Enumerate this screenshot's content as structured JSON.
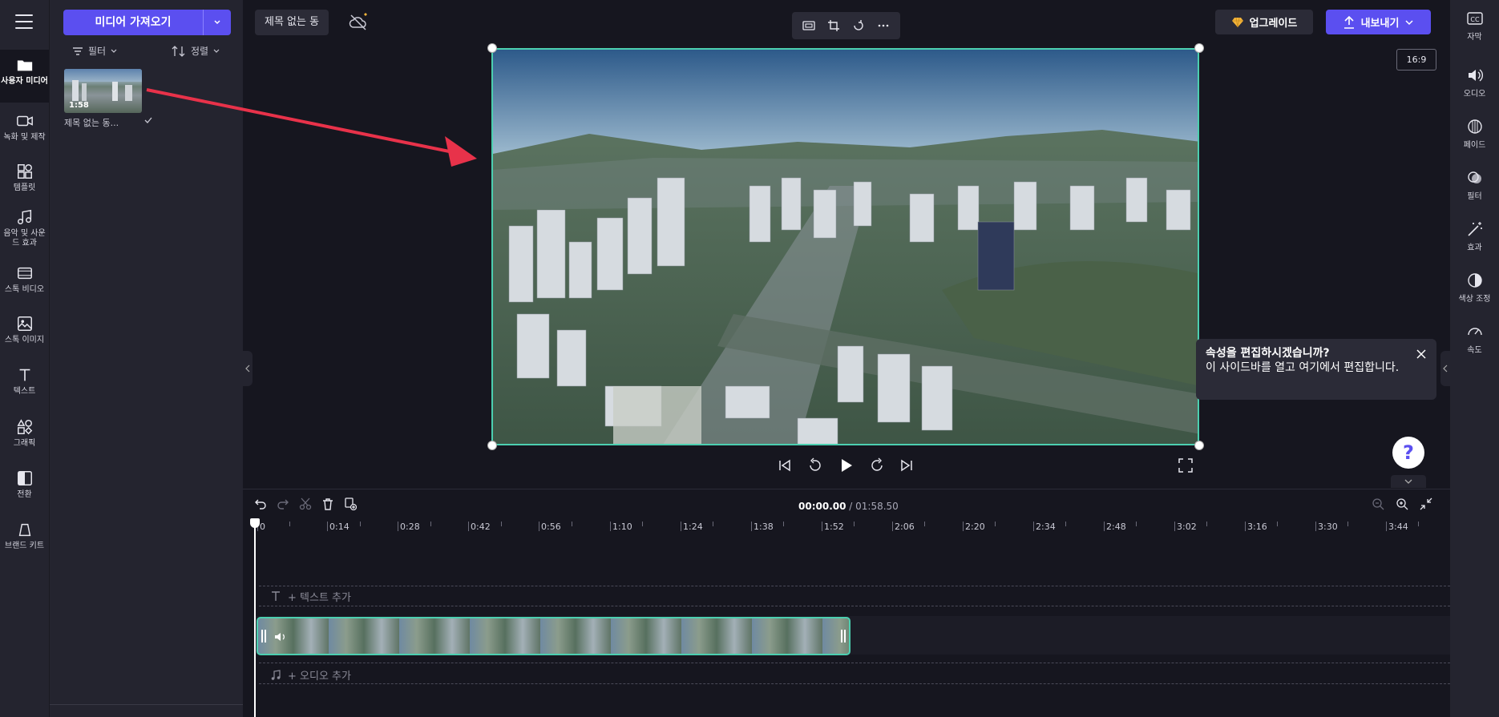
{
  "left_nav": {
    "items": [
      {
        "label": "사용자 미디어"
      },
      {
        "label": "녹화 및 제작"
      },
      {
        "label": "템플릿"
      },
      {
        "label": "음악 및 사운드 효과"
      },
      {
        "label": "스톡 비디오"
      },
      {
        "label": "스톡 이미지"
      },
      {
        "label": "텍스트"
      },
      {
        "label": "그래픽"
      },
      {
        "label": "전환"
      },
      {
        "label": "브랜드 키트"
      }
    ]
  },
  "media_panel": {
    "import_label": "미디어 가져오기",
    "filter_label": "필터",
    "sort_label": "정렬",
    "asset": {
      "duration": "1:58",
      "name": "제목 없는 동..."
    }
  },
  "topbar": {
    "project_title": "제목 없는 동",
    "upgrade_label": "업그레이드",
    "export_label": "내보내기"
  },
  "preview": {
    "aspect_ratio": "16:9"
  },
  "tooltip": {
    "title": "속성을 편집하시겠습니까?",
    "body": "이 사이드바를 열고 여기에서 편집합니다."
  },
  "help": {
    "label": "?"
  },
  "right_bar": {
    "items": [
      {
        "label": "자막",
        "icon": "cc-icon"
      },
      {
        "label": "오디오",
        "icon": "speaker-icon"
      },
      {
        "label": "페이드",
        "icon": "fade-icon"
      },
      {
        "label": "필터",
        "icon": "filter-icon"
      },
      {
        "label": "효과",
        "icon": "magic-wand-icon"
      },
      {
        "label": "색상 조정",
        "icon": "contrast-icon"
      },
      {
        "label": "속도",
        "icon": "speedometer-icon"
      }
    ]
  },
  "timeline": {
    "current_time": "00:00.00",
    "total_time": " / 01:58.50",
    "ruler": [
      "0",
      "0:14",
      "0:28",
      "0:42",
      "0:56",
      "1:10",
      "1:24",
      "1:38",
      "1:52",
      "2:06",
      "2:20",
      "2:34",
      "2:48",
      "3:02",
      "3:16",
      "3:30",
      "3:44"
    ],
    "add_text_label": "+ 텍스트 추가",
    "add_audio_label": "+ 오디오 추가"
  },
  "colors": {
    "accent": "#5b4ff0",
    "selection": "#4ccfb0",
    "arrow": "#e8324a"
  }
}
